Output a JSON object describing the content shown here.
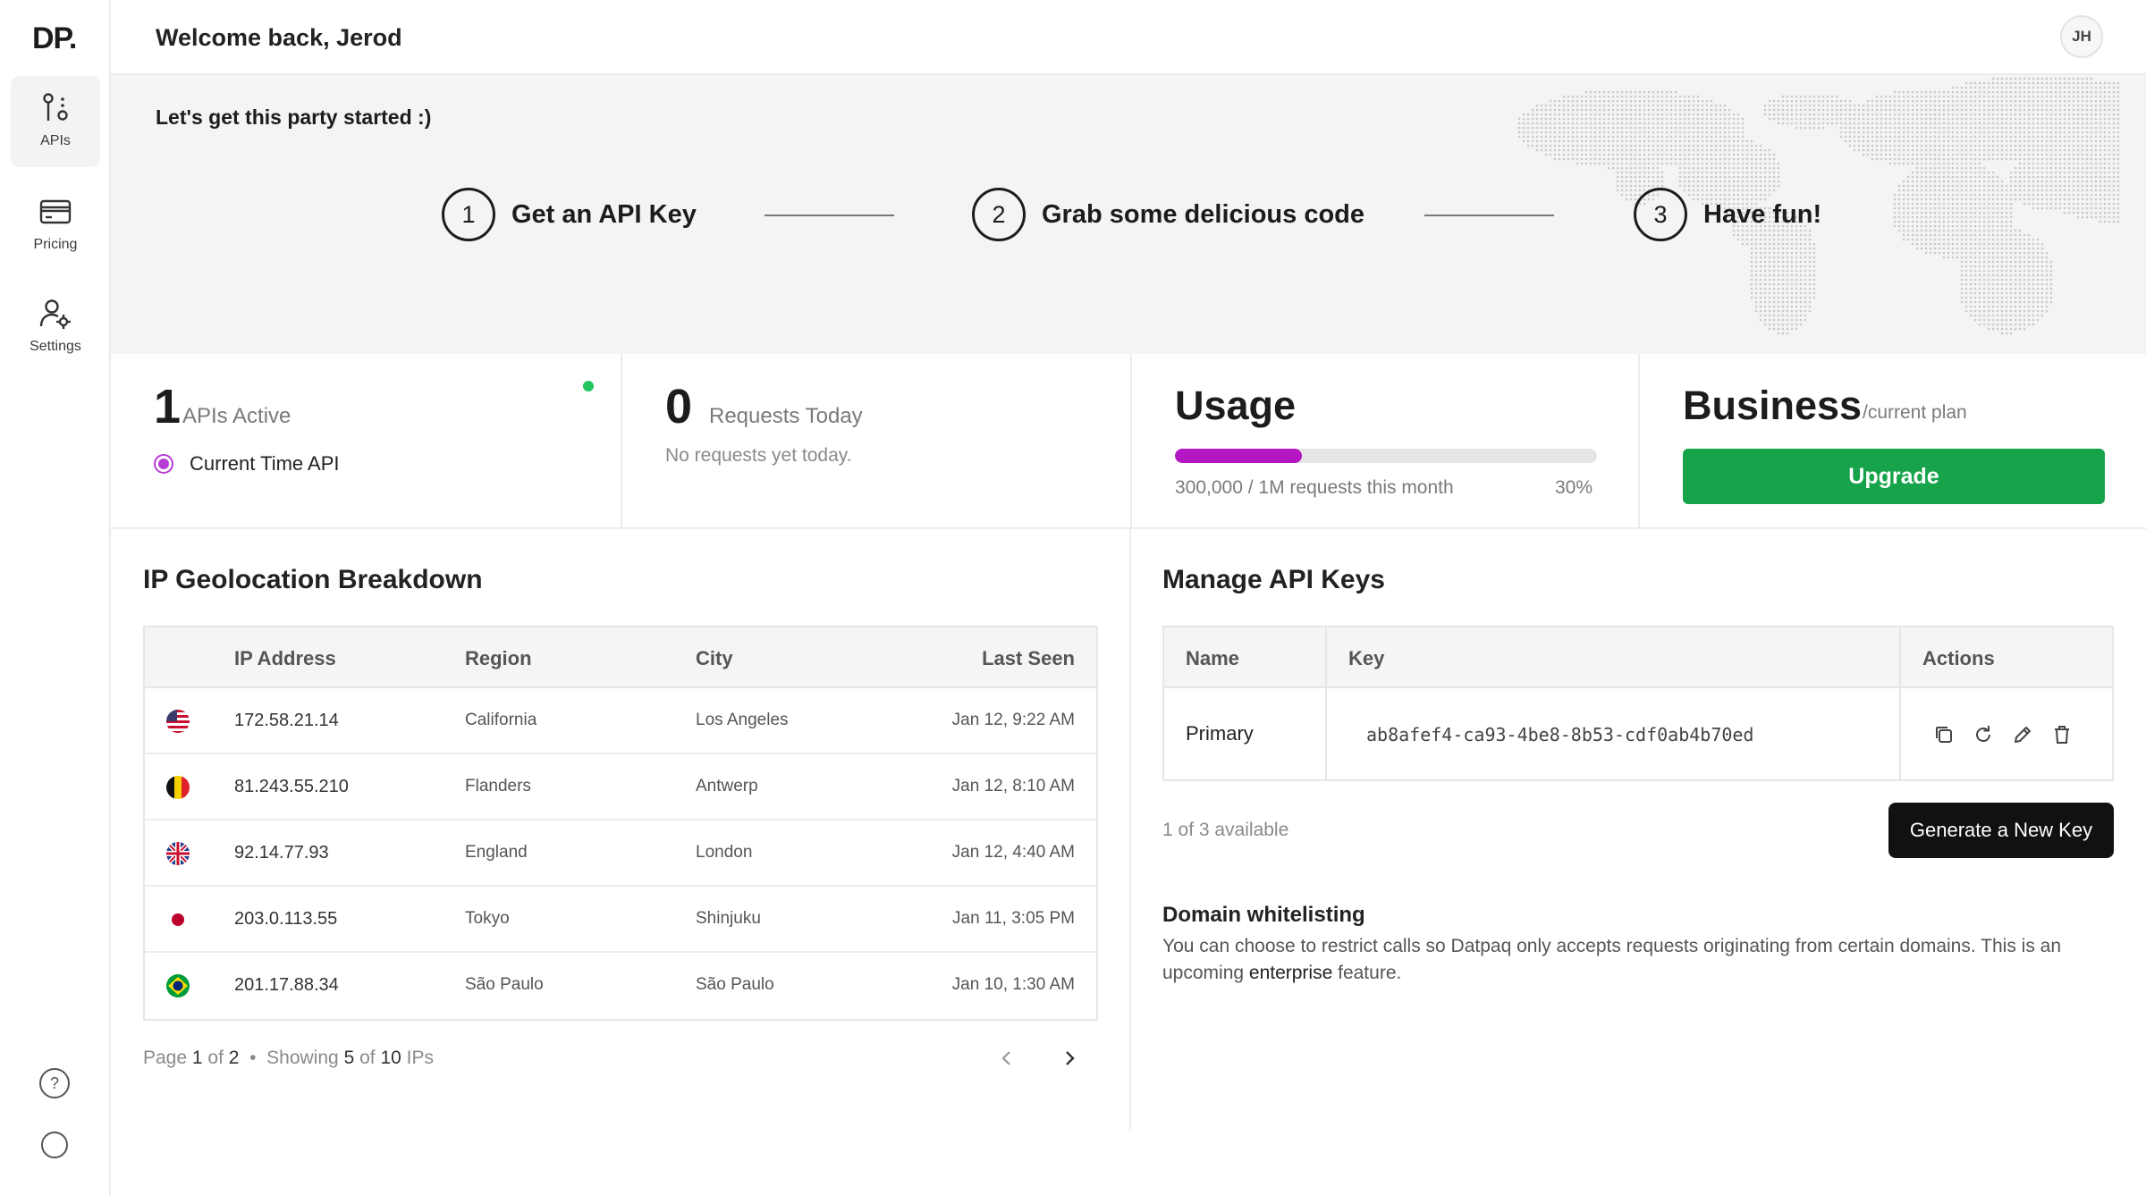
{
  "brand": {
    "logo": "DP."
  },
  "sidebar": {
    "items": [
      {
        "label": "APIs",
        "icon": "api-nodes-icon",
        "active": true
      },
      {
        "label": "Pricing",
        "icon": "credit-card-icon",
        "active": false
      },
      {
        "label": "Settings",
        "icon": "user-settings-icon",
        "active": false
      }
    ],
    "bottom": [
      {
        "icon": "help-icon",
        "glyph": "?"
      },
      {
        "icon": "theme-toggle-icon"
      }
    ]
  },
  "header": {
    "welcome": "Welcome back, Jerod",
    "avatar_initials": "JH"
  },
  "hero": {
    "title": "Let's get this party started :)",
    "steps": [
      {
        "num": "1",
        "label": "Get an API Key"
      },
      {
        "num": "2",
        "label": "Grab some delicious code"
      },
      {
        "num": "3",
        "label": "Have fun!"
      }
    ]
  },
  "stats": {
    "apis": {
      "count": "1",
      "label": "APIs Active",
      "item": "Current Time API",
      "status_color": "#22c55e",
      "item_color": "#b83bd6"
    },
    "requests": {
      "count": "0",
      "label": "Requests Today",
      "sub": "No requests yet today."
    },
    "usage": {
      "title": "Usage",
      "text": "300,000 / 1M requests this month",
      "percent_label": "30%",
      "fraction": 0.3,
      "bar_color": "#b416c4"
    },
    "plan": {
      "title": "Business",
      "sub": "/current plan",
      "button": "Upgrade",
      "button_color": "#16a34a"
    }
  },
  "ip": {
    "title": "IP Geolocation Breakdown",
    "columns": [
      "IP Address",
      "Region",
      "City",
      "Last Seen"
    ],
    "rows": [
      {
        "flag": "us-flag-icon",
        "ip": "172.58.21.14",
        "region": "California",
        "city": "Los Angeles",
        "seen": "Jan 12, 9:22 AM"
      },
      {
        "flag": "belgium-flag-icon",
        "ip": "81.243.55.210",
        "region": "Flanders",
        "city": "Antwerp",
        "seen": "Jan 12, 8:10 AM"
      },
      {
        "flag": "uk-flag-icon",
        "ip": "92.14.77.93",
        "region": "England",
        "city": "London",
        "seen": "Jan 12, 4:40 AM"
      },
      {
        "flag": "japan-flag-icon",
        "ip": "203.0.113.55",
        "region": "Tokyo",
        "city": "Shinjuku",
        "seen": "Jan 11, 3:05 PM"
      },
      {
        "flag": "brazil-flag-icon",
        "ip": "201.17.88.34",
        "region": "São Paulo",
        "city": "São Paulo",
        "seen": "Jan 10, 1:30 AM"
      }
    ],
    "pager": {
      "page_word": "Page",
      "page": "1",
      "of_word": "of",
      "pages": "2",
      "sep": "•",
      "showing_word": "Showing",
      "shown": "5",
      "of_word2": "of",
      "total": "10",
      "unit": "IPs"
    }
  },
  "keys": {
    "title": "Manage API Keys",
    "columns": [
      "Name",
      "Key",
      "Actions"
    ],
    "row": {
      "name": "Primary",
      "key": "ab8afef4-ca93-4be8-8b53-cdf0ab4b70ed"
    },
    "actions": [
      "copy-icon",
      "refresh-icon",
      "edit-icon",
      "delete-icon"
    ],
    "available": "1 of 3 available",
    "generate": "Generate a New Key"
  },
  "domain": {
    "title": "Domain whitelisting",
    "text_before": "You can choose to restrict calls so Datpaq only accepts requests originating from certain domains. This is an upcoming ",
    "text_bold": "enterprise",
    "text_after": " feature."
  }
}
